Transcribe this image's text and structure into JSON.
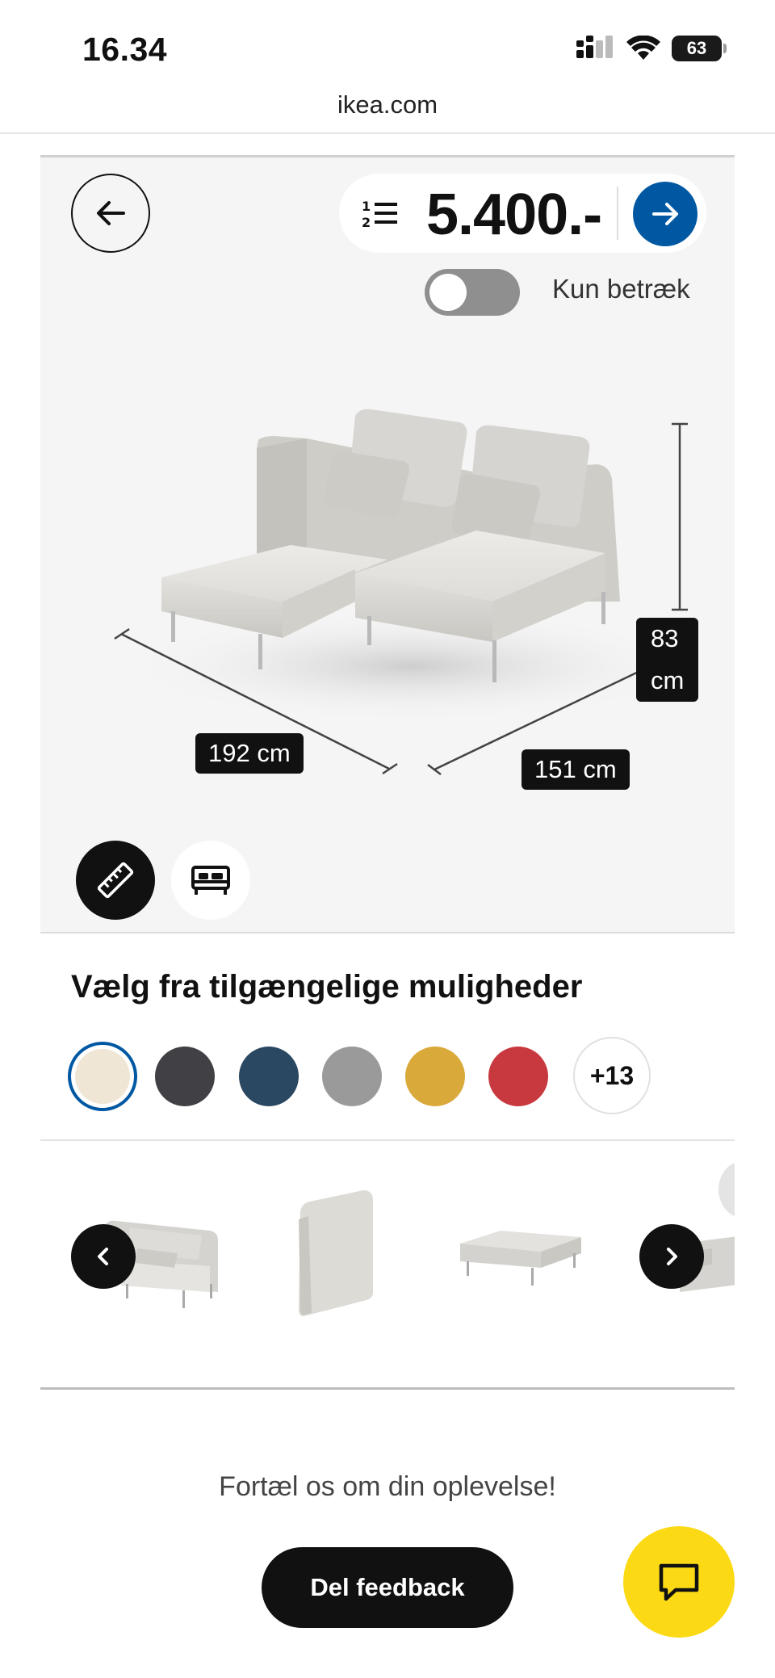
{
  "status_bar": {
    "time": "16.34",
    "battery": "63"
  },
  "browser": {
    "url": "ikea.com"
  },
  "viewer": {
    "price": "5.400.-",
    "toggle_label": "Kun betræk",
    "toggle_on": false,
    "dimensions": {
      "width": "192 cm",
      "depth": "151 cm",
      "height": "83\ncm"
    }
  },
  "options": {
    "title": "Vælg fra tilgængelige muligheder",
    "swatches": [
      "#f0e6d6",
      "#404045",
      "#2b4862",
      "#9a9a9a",
      "#d9a93a",
      "#c8393f"
    ],
    "more_label": "+13"
  },
  "feedback": {
    "prompt": "Fortæl os om din oplevelse!",
    "button_label": "Del feedback"
  },
  "colors": {
    "accent": "#0058a3",
    "chat": "#fbd914"
  }
}
